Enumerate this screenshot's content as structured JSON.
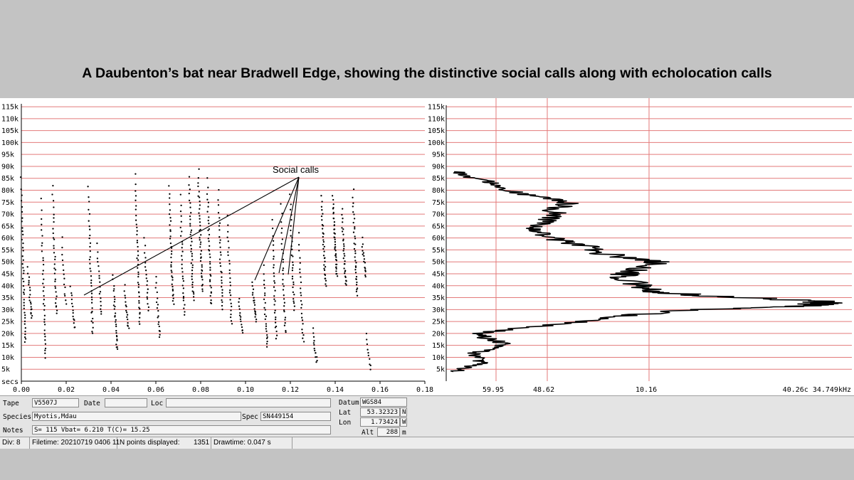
{
  "slide": {
    "title": "A Daubenton’s bat near Bradwell Edge, showing the distinctive social calls along with echolocation calls"
  },
  "annotation": {
    "text": "Social calls"
  },
  "colors": {
    "grid": "#e37a7a",
    "background": "#c3c3c3",
    "panel": "#e4e4e4"
  },
  "chart_data": [
    {
      "type": "scatter",
      "title": "",
      "xlabel": "secs",
      "ylabel": "",
      "y_ticks": [
        "5k",
        "10k",
        "15k",
        "20k",
        "25k",
        "30k",
        "35k",
        "40k",
        "45k",
        "50k",
        "55k",
        "60k",
        "65k",
        "70k",
        "75k",
        "80k",
        "85k",
        "90k",
        "95k",
        "100k",
        "105k",
        "110k",
        "115k"
      ],
      "x_ticks": [
        "0.00",
        "0.02",
        "0.04",
        "0.06",
        "0.08",
        "0.10",
        "0.12",
        "0.14",
        "0.16",
        "0.18"
      ],
      "xlim": [
        0,
        0.18
      ],
      "ylim": [
        0,
        118000
      ],
      "grid": true,
      "series": [
        {
          "calls": [
            {
              "t": 0.0,
              "f_start": 85000,
              "f_end": 16000,
              "n": 42
            },
            {
              "t": 0.003,
              "f_start": 48000,
              "f_end": 26000,
              "n": 20
            },
            {
              "t": 0.009,
              "f_start": 76000,
              "f_end": 10000,
              "n": 36
            },
            {
              "t": 0.014,
              "f_start": 82000,
              "f_end": 28000,
              "n": 32
            },
            {
              "t": 0.018,
              "f_start": 60000,
              "f_end": 32000,
              "n": 14
            },
            {
              "t": 0.022,
              "f_start": 40000,
              "f_end": 22000,
              "n": 14
            },
            {
              "t": 0.03,
              "f_start": 82000,
              "f_end": 20000,
              "n": 36
            },
            {
              "t": 0.034,
              "f_start": 58000,
              "f_end": 28000,
              "n": 18
            },
            {
              "t": 0.041,
              "f_start": 45000,
              "f_end": 13000,
              "n": 28
            },
            {
              "t": 0.046,
              "f_start": 40000,
              "f_end": 22000,
              "n": 16
            },
            {
              "t": 0.051,
              "f_start": 87000,
              "f_end": 24000,
              "n": 40
            },
            {
              "t": 0.055,
              "f_start": 60000,
              "f_end": 30000,
              "n": 18
            },
            {
              "t": 0.06,
              "f_start": 44000,
              "f_end": 18000,
              "n": 18
            },
            {
              "t": 0.066,
              "f_start": 82000,
              "f_end": 32000,
              "n": 36
            },
            {
              "t": 0.071,
              "f_start": 78000,
              "f_end": 28000,
              "n": 30
            },
            {
              "t": 0.075,
              "f_start": 86000,
              "f_end": 34000,
              "n": 38
            },
            {
              "t": 0.079,
              "f_start": 89000,
              "f_end": 38000,
              "n": 40
            },
            {
              "t": 0.083,
              "f_start": 85000,
              "f_end": 32000,
              "n": 36
            },
            {
              "t": 0.088,
              "f_start": 80000,
              "f_end": 30000,
              "n": 30
            },
            {
              "t": 0.092,
              "f_start": 70000,
              "f_end": 24000,
              "n": 26
            },
            {
              "t": 0.097,
              "f_start": 35000,
              "f_end": 20000,
              "n": 14
            },
            {
              "t": 0.103,
              "f_start": 42000,
              "f_end": 25000,
              "n": 18
            },
            {
              "t": 0.108,
              "f_start": 48000,
              "f_end": 14000,
              "n": 24
            },
            {
              "t": 0.112,
              "f_start": 68000,
              "f_end": 18000,
              "n": 30
            },
            {
              "t": 0.116,
              "f_start": 74000,
              "f_end": 20000,
              "n": 30
            },
            {
              "t": 0.12,
              "f_start": 78000,
              "f_end": 30000,
              "n": 30
            },
            {
              "t": 0.124,
              "f_start": 62000,
              "f_end": 16000,
              "n": 24
            },
            {
              "t": 0.13,
              "f_start": 22000,
              "f_end": 8000,
              "n": 14
            },
            {
              "t": 0.134,
              "f_start": 78000,
              "f_end": 40000,
              "n": 34
            },
            {
              "t": 0.139,
              "f_start": 78000,
              "f_end": 44000,
              "n": 40
            },
            {
              "t": 0.143,
              "f_start": 72000,
              "f_end": 40000,
              "n": 30
            },
            {
              "t": 0.148,
              "f_start": 80000,
              "f_end": 36000,
              "n": 34
            },
            {
              "t": 0.152,
              "f_start": 60000,
              "f_end": 44000,
              "n": 16
            },
            {
              "t": 0.154,
              "f_start": 20000,
              "f_end": 5000,
              "n": 10
            }
          ]
        }
      ]
    },
    {
      "type": "line",
      "title": "",
      "xlabel": "",
      "ylabel": "",
      "y_ticks": [
        "5k",
        "10k",
        "15k",
        "20k",
        "25k",
        "30k",
        "35k",
        "40k",
        "45k",
        "50k",
        "55k",
        "60k",
        "65k",
        "70k",
        "75k",
        "80k",
        "85k",
        "90k",
        "95k",
        "100k",
        "105k",
        "110k",
        "115k"
      ],
      "x_ticks": [
        "59.95",
        "48.62",
        "10.16"
      ],
      "ylim": [
        0,
        118000
      ],
      "grid": true,
      "series": [
        {
          "freq_khz": [
            4,
            6,
            8,
            10,
            12,
            14,
            16,
            18,
            20,
            22,
            24,
            26,
            28,
            30,
            31,
            32,
            33,
            34,
            35,
            36,
            37,
            38,
            40,
            42,
            44,
            46,
            48,
            50,
            52,
            54,
            56,
            58,
            60,
            62,
            64,
            66,
            68,
            70,
            72,
            74,
            76,
            78,
            80,
            82,
            84,
            86,
            88
          ],
          "level": [
            0.02,
            0.05,
            0.09,
            0.08,
            0.07,
            0.12,
            0.14,
            0.1,
            0.08,
            0.17,
            0.3,
            0.36,
            0.48,
            0.62,
            0.82,
            0.9,
            0.94,
            0.86,
            0.75,
            0.62,
            0.55,
            0.5,
            0.48,
            0.45,
            0.43,
            0.46,
            0.5,
            0.52,
            0.44,
            0.37,
            0.36,
            0.3,
            0.26,
            0.23,
            0.22,
            0.23,
            0.25,
            0.28,
            0.26,
            0.3,
            0.28,
            0.2,
            0.16,
            0.12,
            0.1,
            0.05,
            0.02
          ]
        }
      ]
    }
  ],
  "readout": {
    "text": "40.26c 34.749kHz"
  },
  "panel": {
    "tape_label": "Tape",
    "tape_value": "V5507J",
    "date_label": "Date",
    "date_value": "",
    "loc_label": "Loc",
    "loc_value": "",
    "species_label": "Species",
    "species_value": "Myotis,Mdau",
    "spec_label": "Spec",
    "spec_value": "SN449154",
    "notes_label": "Notes",
    "notes_value": "S= 115  Vbat=  6.210  T(C)=  15.25",
    "datum_label": "Datum",
    "datum_value": "WGS84",
    "lat_label": "Lat",
    "lat_value": "53.32323",
    "lat_dir": "N",
    "lon_label": "Lon",
    "lon_value": "1.73424",
    "lon_dir": "W",
    "alt_label": "Alt",
    "alt_value": "288",
    "alt_unit": "m"
  },
  "status": {
    "div": "Div: 8",
    "filetime": "Filetime: 20210719 0406 11",
    "npoints_label": "N points displayed:",
    "npoints_value": "1351",
    "drawtime": "Drawtime: 0.047 s"
  }
}
